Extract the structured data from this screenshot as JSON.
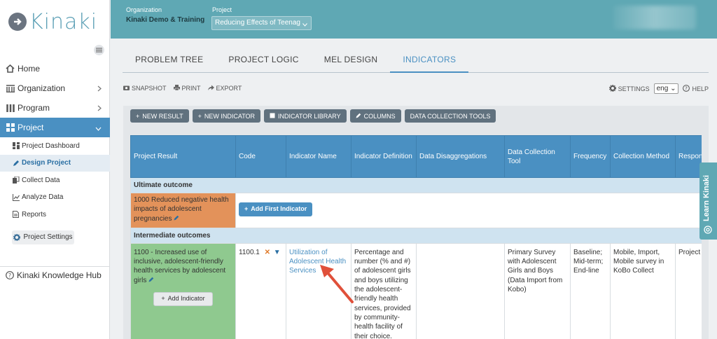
{
  "app": {
    "name": "Kinaki"
  },
  "sidebar": {
    "items": [
      {
        "label": "Home",
        "icon": "home-icon"
      },
      {
        "label": "Organization",
        "icon": "building-icon"
      },
      {
        "label": "Program",
        "icon": "columns-icon"
      },
      {
        "label": "Project",
        "icon": "grid-icon"
      }
    ],
    "sub_items": [
      {
        "label": "Project Dashboard",
        "icon": "dashboard-icon"
      },
      {
        "label": "Design Project",
        "icon": "pencil-icon"
      },
      {
        "label": "Collect Data",
        "icon": "copy-icon"
      },
      {
        "label": "Analyze Data",
        "icon": "line-chart-icon"
      },
      {
        "label": "Reports",
        "icon": "document-icon"
      }
    ],
    "settings_label": "Project Settings",
    "hub_label": "Kinaki Knowledge Hub"
  },
  "header": {
    "org_label": "Organization",
    "org_value": "Kinaki Demo & Training",
    "project_label": "Project",
    "project_value": "Reducing Effects of Teenag"
  },
  "tabs": [
    {
      "label": "PROBLEM TREE"
    },
    {
      "label": "PROJECT LOGIC"
    },
    {
      "label": "MEL DESIGN"
    },
    {
      "label": "INDICATORS"
    }
  ],
  "actions": {
    "snapshot": "SNAPSHOT",
    "print": "PRINT",
    "export": "EXPORT",
    "settings": "SETTINGS",
    "lang": "eng",
    "help": "HELP"
  },
  "toolbar": {
    "new_result": "NEW RESULT",
    "new_indicator": "NEW INDICATOR",
    "indicator_library": "INDICATOR LIBRARY",
    "columns": "COLUMNS",
    "data_collection_tools": "DATA COLLECTION TOOLS"
  },
  "table": {
    "headers": [
      "Project Result",
      "Code",
      "Indicator Name",
      "Indicator Definition",
      "Data Disaggregations",
      "Data Collection Tool",
      "Frequency",
      "Collection Method",
      "Respons"
    ],
    "section1": "Ultimate outcome",
    "row1_result": "1000 Reduced negative health impacts of adolescent pregnancies",
    "add_first": "Add First Indicator",
    "section2": "Intermediate outcomes",
    "row2": {
      "result": "1100 - Increased use of inclusive, adolescent-friendly health services by adolescent girls",
      "add_indicator": "Add Indicator",
      "code": "1100.1",
      "indicator_name": "Utilization of Adolescent Health Services",
      "definition": "Percentage and number (% and #) of adolescent girls and boys utilizing the adolescent-friendly health services, provided by community-health facility of their choice.",
      "tool": "Primary Survey with Adolescent Girls and Boys (Data Import from Kobo)",
      "frequency": "Baseline; Mid-term; End-line",
      "method": "Mobile, Import, Mobile survey in KoBo Collect",
      "responsible": "Project"
    }
  },
  "learn_tab": "Learn Kinaki",
  "colors": {
    "accent": "#4a90c2",
    "header": "#5fa8b4",
    "orange": "#e3925a",
    "green": "#8fc98f",
    "arrow": "#e0503a"
  }
}
